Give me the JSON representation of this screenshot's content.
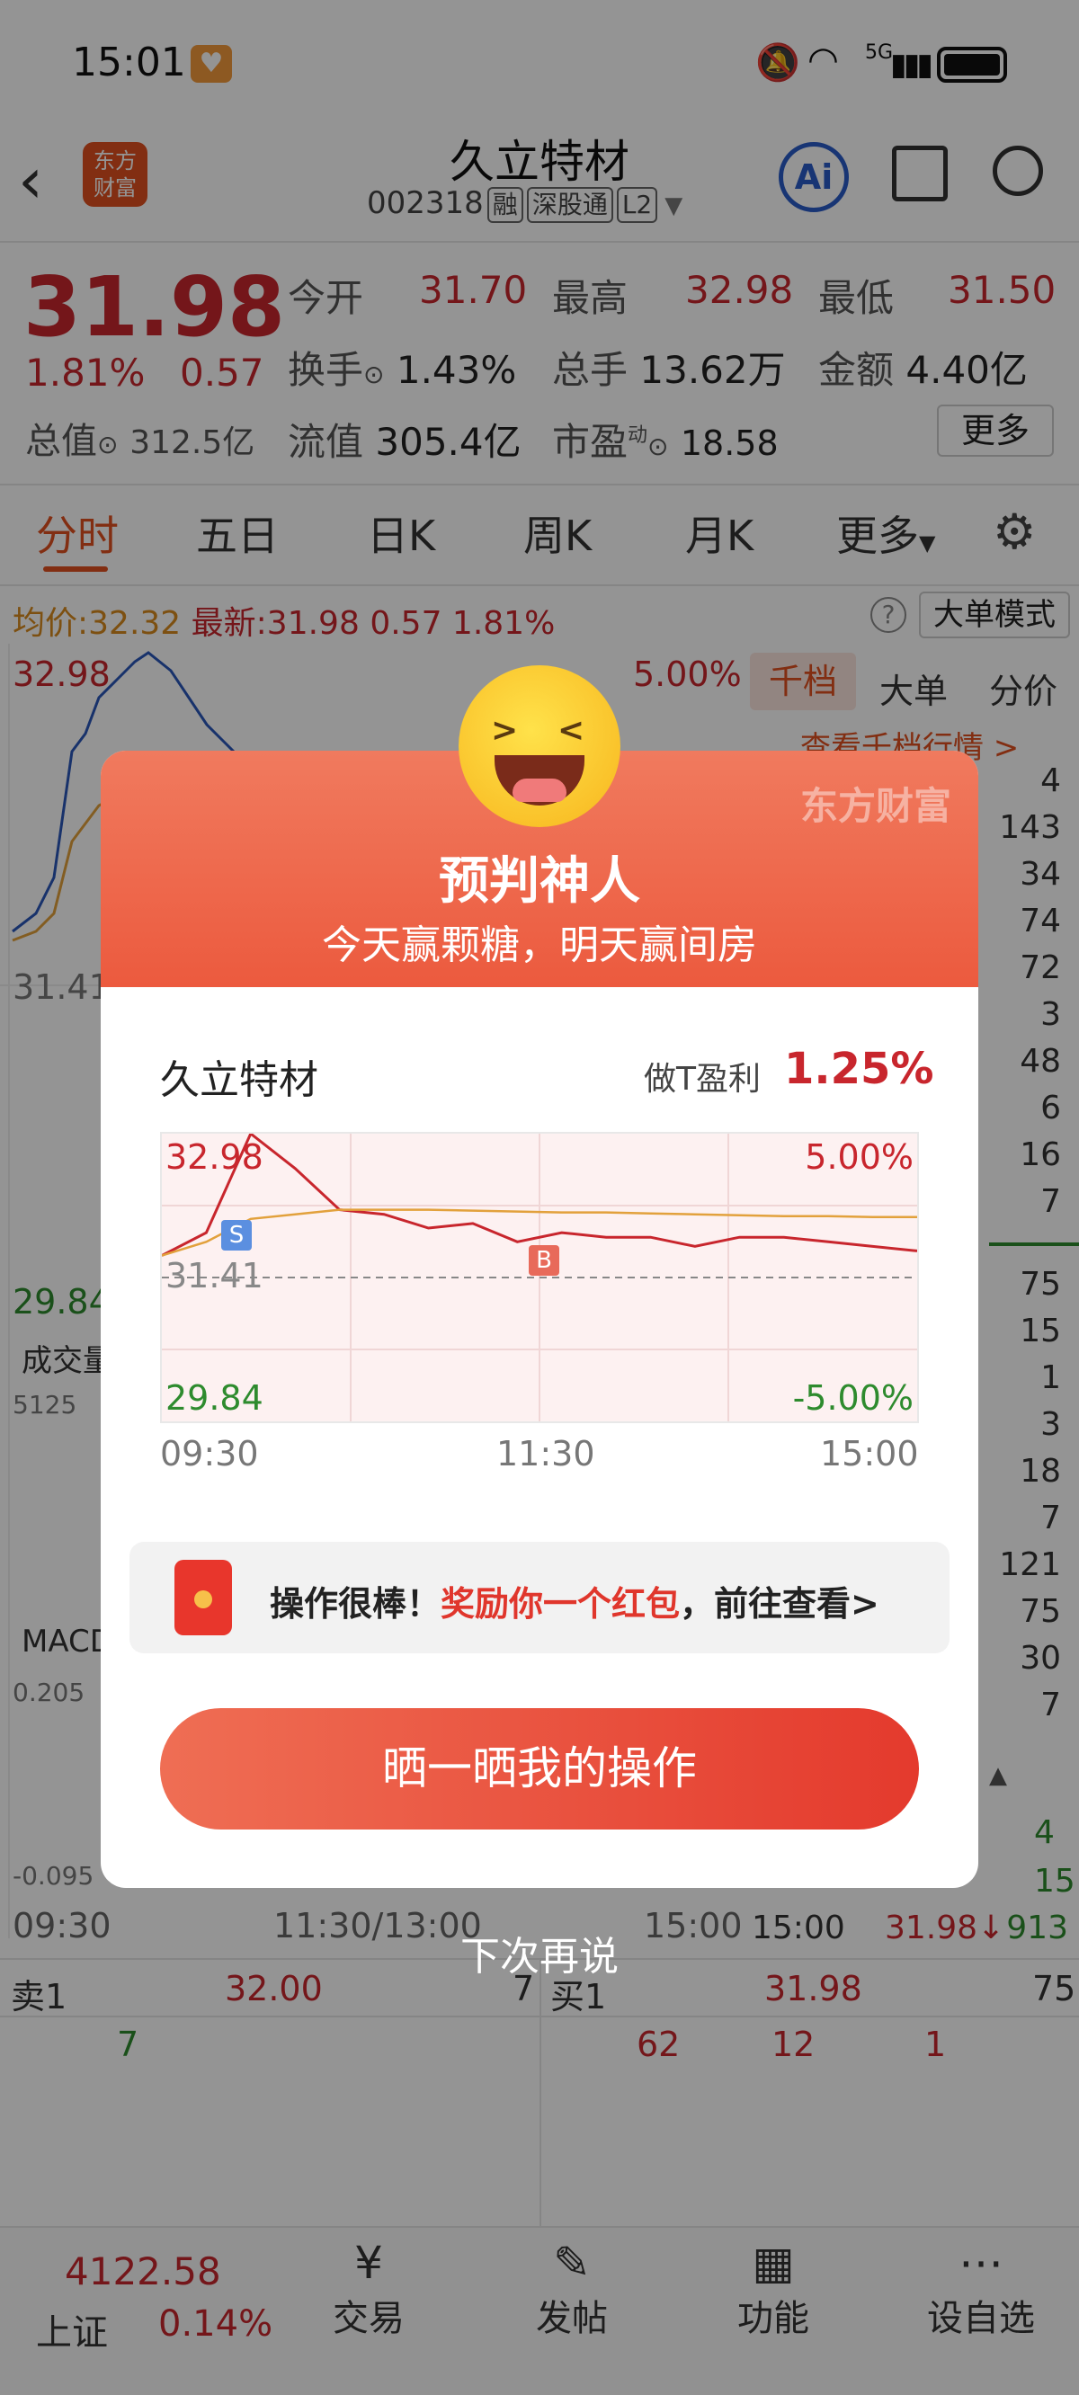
{
  "status_bar": {
    "time": "15:01",
    "network": "5G"
  },
  "header": {
    "brand_line1": "东方",
    "brand_line2": "财富",
    "title": "久立特材",
    "code": "002318",
    "tags": [
      "融",
      "深股通",
      "L2"
    ],
    "ai_label": "Ai"
  },
  "quote": {
    "price": "31.98",
    "change_pct": "1.81%",
    "change": "0.57",
    "stats": [
      {
        "label": "今开",
        "value": "31.70"
      },
      {
        "label": "最高",
        "value": "32.98"
      },
      {
        "label": "最低",
        "value": "31.50"
      },
      {
        "label": "换手",
        "value": "1.43%"
      },
      {
        "label": "总手",
        "value": "13.62万"
      },
      {
        "label": "金额",
        "value": "4.40亿"
      },
      {
        "label": "总值",
        "value": "312.5亿"
      },
      {
        "label": "流值",
        "value": "305.4亿"
      },
      {
        "label": "市盈",
        "value": "18.58"
      }
    ],
    "pe_sup": "动",
    "more_label": "更多"
  },
  "tabs": [
    "分时",
    "五日",
    "日K",
    "周K",
    "月K",
    "更多"
  ],
  "info_line": {
    "avg_label": "均价:",
    "avg": "32.32",
    "latest_label": "最新:",
    "latest": "31.98",
    "chg": "0.57",
    "pct": "1.81%",
    "big_order_mode": "大单模式"
  },
  "side_tabs": [
    "千档",
    "大单",
    "分价"
  ],
  "side_link": "查看千档行情 >",
  "depth_sell": [
    "4",
    "143",
    "34",
    "74",
    "72",
    "3",
    "48",
    "6",
    "16",
    "7"
  ],
  "depth_buy": [
    "75",
    "15",
    "1",
    "3",
    "18",
    "7",
    "121",
    "75",
    "30",
    "7"
  ],
  "chart_labels": {
    "high": "32.98",
    "mid": "31.41",
    "low": "29.84",
    "top_pct": "5.00%",
    "volume": "成交量",
    "vol_max": "5125",
    "macd": "MACD",
    "macd_hi": "0.205",
    "macd_lo": "-0.095",
    "t_start": "09:30",
    "t_mid": "11:30/13:00",
    "t_end": "15:00"
  },
  "ticks": [
    {
      "time": "15:00",
      "price": "31.98↓",
      "vol": "913"
    }
  ],
  "tick_partial": [
    "4",
    "15"
  ],
  "orderbook": {
    "sell_label": "卖1",
    "sell_price": "32.00",
    "sell_vol": "7",
    "buy_label": "买1",
    "buy_price": "31.98",
    "buy_vol": "75",
    "queue_left": [
      "7"
    ],
    "queue_right": [
      "62",
      "12",
      "1"
    ]
  },
  "bottom_nav": {
    "index_value": "4122.58",
    "index_name": "上证",
    "index_pct": "0.14%",
    "items": [
      "交易",
      "发帖",
      "功能",
      "设自选"
    ]
  },
  "modal": {
    "brand": "东方财富",
    "title": "预判神人",
    "subtitle": "今天赢颗糖，明天赢间房",
    "stock_name": "久立特材",
    "profit_label": "做T盈利",
    "profit_value": "1.25%",
    "chart_high": "32.98",
    "chart_mid": "31.41",
    "chart_low": "29.84",
    "pct_high": "5.00%",
    "pct_low": "-5.00%",
    "time_start": "09:30",
    "time_mid": "11:30",
    "time_end": "15:00",
    "sell_marker": "S",
    "buy_marker": "B",
    "reward_prefix": "操作很棒！",
    "reward_highlight": "奖励你一个红包",
    "reward_suffix": "，前往查看>",
    "cta": "晒一晒我的操作",
    "dismiss": "下次再说"
  },
  "colors": {
    "up_red": "#c8262d",
    "down_green": "#2e8b2e",
    "cta_start": "#ef6e54",
    "cta_end": "#e43a2d"
  },
  "chart_data": {
    "type": "line",
    "title": "",
    "x": [
      "09:30",
      "11:30",
      "15:00"
    ],
    "series": [
      {
        "values": [
          31.65,
          31.9,
          32.98,
          32.6,
          32.15,
          32.1,
          31.95,
          32.0,
          31.8,
          31.9,
          31.85,
          31.85,
          31.75,
          31.85,
          31.85,
          31.8,
          31.75,
          31.7
        ]
      },
      {
        "values": [
          31.65,
          31.8,
          32.05,
          32.1,
          32.15,
          32.15,
          32.15,
          32.14,
          32.13,
          32.12,
          32.12,
          32.11,
          32.1,
          32.09,
          32.08,
          32.08,
          32.07,
          32.07
        ]
      }
    ],
    "ylim": [
      29.84,
      32.98
    ],
    "grid": true
  }
}
